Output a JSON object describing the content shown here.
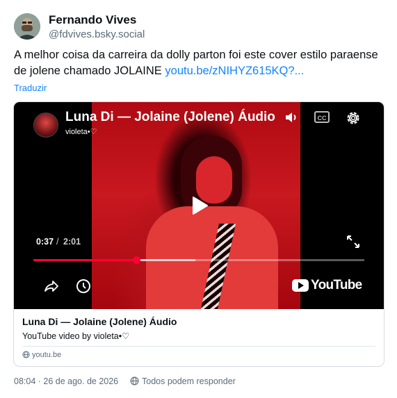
{
  "author": {
    "display_name": "Fernando Vives",
    "handle": "@fdvives.bsky.social"
  },
  "post": {
    "text": "A melhor coisa da carreira da dolly parton foi este cover estilo paraense de jolene chamado JOLAINE",
    "link_text": "youtu.be/zNIHYZ615KQ?...",
    "translate_label": "Traduzir"
  },
  "video": {
    "title": "Luna Di — Jolaine (Jolene) Áudio",
    "channel": "violeta•♡",
    "current_time": "0:37",
    "separator": "/",
    "total_time": "2:01",
    "progress_fraction": 0.31,
    "buffered_fraction": 0.49,
    "cc_label": "CC",
    "logo_text": "YouTube",
    "accent_color": "#ff0033"
  },
  "card": {
    "title": "Luna Di — Jolaine (Jolene) Áudio",
    "description": "YouTube video by violeta•♡",
    "domain": "youtu.be"
  },
  "meta": {
    "timestamp": "08:04 · 26 de ago. de 2026",
    "reply_setting": "Todos podem responder"
  },
  "colors": {
    "link": "#1083fe",
    "secondary_text": "#5b6b7a"
  }
}
